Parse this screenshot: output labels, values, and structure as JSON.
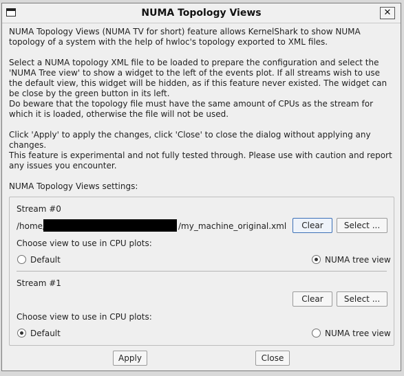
{
  "window": {
    "title": "NUMA Topology Views",
    "close_glyph": "✕"
  },
  "description": [
    "NUMA Topology Views (NUMA TV for short) feature allows KernelShark to show NUMA topology of a system with the help of hwloc's topology exported to XML files.",
    "Select a NUMA topology XML file to be loaded to prepare the configuration and select the 'NUMA Tree view' to show a widget to the left of the events plot. If all streams wish to use the default view, this widget will be hidden, as if this feature never existed. The widget can be close by the green button in its left.",
    "Do beware that the topology file must have the same amount of CPUs as the stream for which it is loaded, otherwise the file will not be used.",
    "Click 'Apply' to apply the changes, click 'Close' to close the dialog without applying any changes.",
    "This feature is experimental and not fully tested through. Please use with caution and report any issues you encounter."
  ],
  "settings_label": "NUMA Topology Views settings:",
  "streams": [
    {
      "title": "Stream #0",
      "path_prefix": "/home/",
      "path_suffix": "/my_machine_original.xml",
      "clear_label": "Clear",
      "select_label": "Select ...",
      "choose_label": "Choose view to use in CPU plots:",
      "default_label": "Default",
      "tree_label": "NUMA tree view",
      "selected": "tree"
    },
    {
      "title": "Stream #1",
      "path_prefix": "",
      "path_suffix": "",
      "clear_label": "Clear",
      "select_label": "Select ...",
      "choose_label": "Choose view to use in CPU plots:",
      "default_label": "Default",
      "tree_label": "NUMA tree view",
      "selected": "default"
    }
  ],
  "footer": {
    "apply_label": "Apply",
    "close_label": "Close"
  }
}
